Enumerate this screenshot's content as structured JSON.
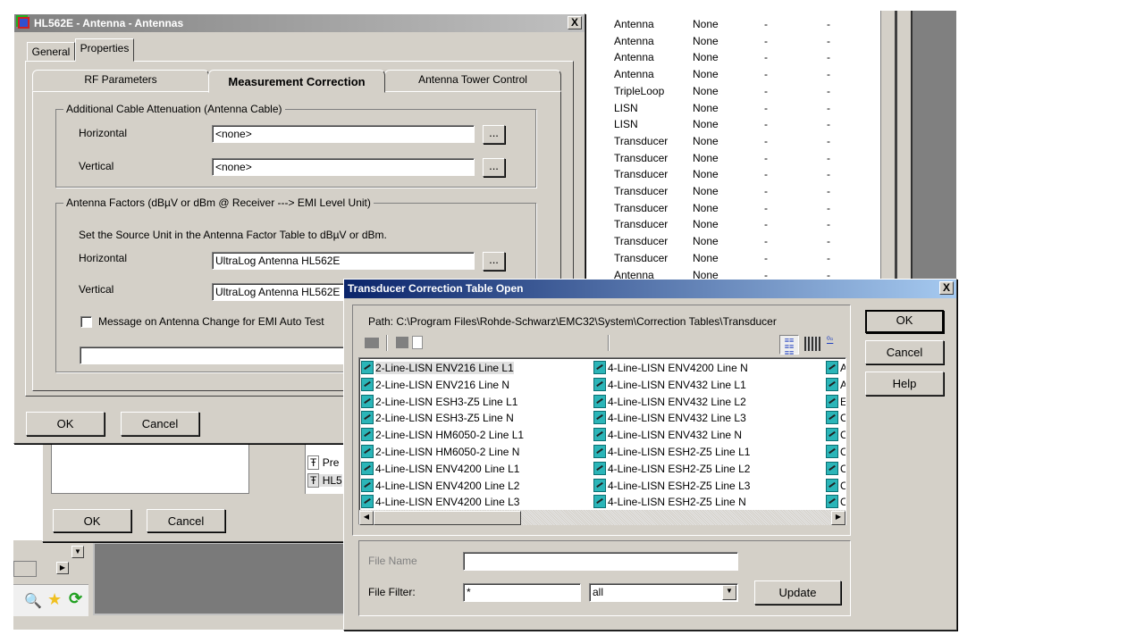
{
  "bg_list": {
    "rows": [
      [
        "Antenna",
        "None",
        "-",
        "-"
      ],
      [
        "Antenna",
        "None",
        "-",
        "-"
      ],
      [
        "Antenna",
        "None",
        "-",
        "-"
      ],
      [
        "Antenna",
        "None",
        "-",
        "-"
      ],
      [
        "TripleLoop",
        "None",
        "-",
        "-"
      ],
      [
        "LISN",
        "None",
        "-",
        "-"
      ],
      [
        "LISN",
        "None",
        "-",
        "-"
      ],
      [
        "Transducer",
        "None",
        "-",
        "-"
      ],
      [
        "Transducer",
        "None",
        "-",
        "-"
      ],
      [
        "Transducer",
        "None",
        "-",
        "-"
      ],
      [
        "Transducer",
        "None",
        "-",
        "-"
      ],
      [
        "Transducer",
        "None",
        "-",
        "-"
      ],
      [
        "Transducer",
        "None",
        "-",
        "-"
      ],
      [
        "Transducer",
        "None",
        "-",
        "-"
      ],
      [
        "Transducer",
        "None",
        "-",
        "-"
      ],
      [
        "Antenna",
        "None",
        "-",
        "-"
      ]
    ]
  },
  "bg_dialog": {
    "ok_label": "OK",
    "cancel_label": "Cancel",
    "list_items": [
      "Pre",
      "HL5"
    ]
  },
  "antenna_dialog": {
    "title": "HL562E - Antenna - Antennas",
    "close_label": "X",
    "tabs": [
      "General",
      "Properties"
    ],
    "subtabs": [
      "RF Parameters",
      "Measurement Correction",
      "Antenna Tower Control"
    ],
    "cable_group": {
      "legend": "Additional Cable Attenuation (Antenna Cable)",
      "horizontal_label": "Horizontal",
      "horizontal_value": "<none>",
      "vertical_label": "Vertical",
      "vertical_value": "<none>",
      "browse_label": "..."
    },
    "factors_group": {
      "legend": "Antenna Factors (dBµV or dBm @ Receiver  --->  EMI Level Unit)",
      "hint": "Set the Source Unit in the Antenna Factor Table to dBµV or dBm.",
      "horizontal_label": "Horizontal",
      "horizontal_value": "UltraLog Antenna HL562E",
      "vertical_label": "Vertical",
      "vertical_value": "UltraLog Antenna HL562E",
      "browse_label": "...",
      "checkbox_label": "Message on Antenna Change for EMI Auto Test",
      "checkbox_checked": false
    },
    "ok_label": "OK",
    "cancel_label": "Cancel"
  },
  "transducer_dialog": {
    "title": "Transducer Correction Table Open",
    "close_label": "X",
    "path": "Path: C:\\Program Files\\Rohde-Schwarz\\EMC32\\System\\Correction Tables\\Transducer",
    "ok_label": "OK",
    "cancel_label": "Cancel",
    "help_label": "Help",
    "files_col1": [
      "2-Line-LISN ENV216 Line L1",
      "2-Line-LISN ENV216 Line N",
      "2-Line-LISN ESH3-Z5 Line L1",
      "2-Line-LISN ESH3-Z5 Line N",
      "2-Line-LISN HM6050-2 Line L1",
      "2-Line-LISN HM6050-2 Line N",
      "4-Line-LISN ENV4200 Line L1",
      "4-Line-LISN ENV4200 Line L2",
      "4-Line-LISN ENV4200 Line L3"
    ],
    "files_col2": [
      "4-Line-LISN ENV4200 Line N",
      "4-Line-LISN ENV432 Line L1",
      "4-Line-LISN ENV432 Line L2",
      "4-Line-LISN ENV432 Line L3",
      "4-Line-LISN ENV432 Line N",
      "4-Line-LISN ESH2-Z5 Line L1",
      "4-Line-LISN ESH2-Z5 Line L2",
      "4-Line-LISN ESH2-Z5 Line L3",
      "4-Line-LISN ESH2-Z5 Line N"
    ],
    "files_col3": [
      "A",
      "A",
      "E",
      "C",
      "C",
      "C",
      "C",
      "C",
      "C"
    ],
    "selected_file": "2-Line-LISN ENV216 Line L1",
    "file_name_label": "File Name",
    "file_name_value": "",
    "file_filter_label": "File Filter:",
    "file_filter_value": "*",
    "filter_type_value": "all",
    "update_label": "Update"
  }
}
